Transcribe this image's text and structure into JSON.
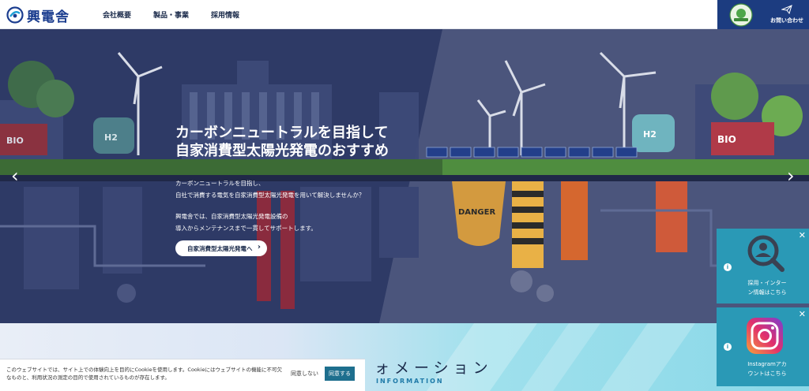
{
  "header": {
    "logo_text": "興電舎",
    "nav": [
      "会社概要",
      "製品・事業",
      "採用情報"
    ],
    "contact_label": "お問い合わせ"
  },
  "hero": {
    "title_lines": [
      "カーボンニュートラルを目指して",
      "自家消費型太陽光発電のおすすめ"
    ],
    "body_lines": [
      "カーボンニュートラルを目指し、",
      "自社で消費する電気を自家消費型太陽光発電を用いて解決しませんか？",
      "興電舎では、自家消費型太陽光発電設備の",
      "導入からメンテナンスまで一貫してサポートします。"
    ],
    "cta_label": "自家消費型太陽光発電へ",
    "prev_arrow": "‹",
    "next_arrow": "›"
  },
  "section": {
    "title": "ォメーション",
    "subtitle": "INFORMATION"
  },
  "cookie": {
    "text": "このウェブサイトでは、サイト上での体験向上を目的にCookieを使用します。Cookieにはウェブサイトの機能に不可欠なものと、利用状況の測定の目的で使用されているものが存在します。",
    "decline_label": "同意しない",
    "accept_label": "同意する"
  },
  "widgets": [
    {
      "label_lines": [
        "採用・インター",
        "ン情報はこちら"
      ],
      "icon": "recruit-search-icon"
    },
    {
      "label_lines": [
        "Instagramアカ",
        "ウントはこちら"
      ],
      "icon": "instagram-icon"
    }
  ],
  "colors": {
    "brand_navy": "#1c3c80",
    "widget_teal": "#2a99b6",
    "accept_button": "#1e6f8e"
  }
}
